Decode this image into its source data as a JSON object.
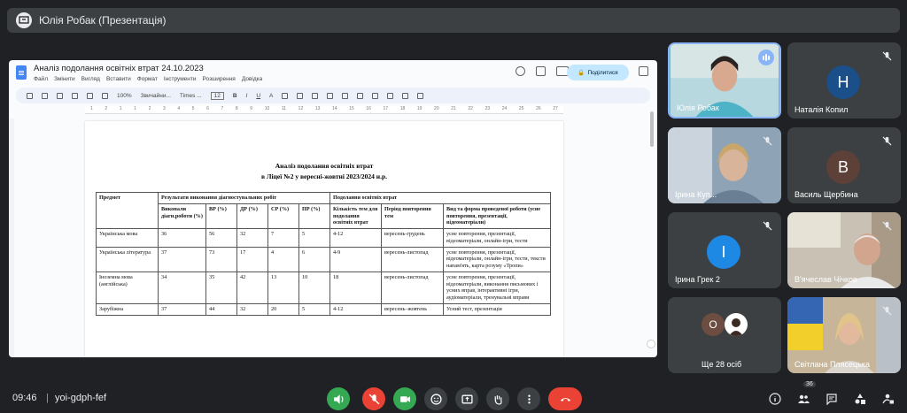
{
  "topbar": {
    "title": "Юлія Робак (Презентація)"
  },
  "doc": {
    "title": "Аналіз подолання освітніх втрат 24.10.2023",
    "menu": [
      "Файл",
      "Змінити",
      "Вигляд",
      "Вставити",
      "Формат",
      "Інструменти",
      "Розширення",
      "Довідка"
    ],
    "share_label": "Поділитися",
    "toolbar": {
      "zoom": "100%",
      "style": "Звичайни...",
      "font": "Times ...",
      "size": "12"
    },
    "ruler": [
      "1",
      "2",
      "1",
      "1",
      "2",
      "3",
      "4",
      "5",
      "6",
      "7",
      "8",
      "9",
      "10",
      "11",
      "12",
      "13",
      "14",
      "15",
      "16",
      "17",
      "18",
      "19",
      "20",
      "21",
      "22",
      "23",
      "24",
      "25",
      "26",
      "27"
    ],
    "heading1": "Аналіз подолання освітніх втрат",
    "heading2": "в Ліцеї №2 у вересні-жовтні 2023/2024 н.р.",
    "table": {
      "h_subject": "Предмет",
      "h_results": "Результати виконання діагностувальних робіт",
      "h_overcome": "Подолання освітніх втрат",
      "sub": [
        "Виконали діагн.роботи (%)",
        "ВР (%)",
        "ДР (%)",
        "СР (%)",
        "ПР (%)",
        "Кількість тем для подолання освітніх втрат",
        "Період повторення тем",
        "Вид та форма проведеної роботи (усне повторення, презентації, відеоматеріали)"
      ],
      "rows": [
        [
          "Українська мова",
          "36",
          "56",
          "32",
          "7",
          "5",
          "4-12",
          "вересень-грудень",
          "усне повторення, презентації, відеоматеріали, онлайн-ігри, тести"
        ],
        [
          "Українська література",
          "37",
          "73",
          "17",
          "4",
          "6",
          "4-9",
          "вересень-листопад",
          "усне повторення, презентації, відеоматеріали, онлайн-ігри, тести, тексти напам'ять, карта розуму «Тропи»"
        ],
        [
          "Іноземна мова (англійська)",
          "34",
          "35",
          "42",
          "13",
          "10",
          "18",
          "вересень-листопад",
          "усне повторення, презентації, відеоматеріали, виконання письмових і усних вправ, інтерактивні ігри, аудіоматеріали, тренувальні вправи"
        ],
        [
          "Зарубіжна",
          "37",
          "44",
          "32",
          "20",
          "5",
          "4-12",
          "вересень–жовтень",
          "Усний тест, презентація"
        ]
      ]
    }
  },
  "participants": {
    "yulia": {
      "name": "Юлія Робак"
    },
    "natalia": {
      "name": "Наталія Копил",
      "initial": "Н",
      "color": "#1a4f8a"
    },
    "iryna_k": {
      "name": "Ірина Куп..."
    },
    "vasyl": {
      "name": "Василь Щербина",
      "initial": "В",
      "color": "#5d4037"
    },
    "iryna_g": {
      "name": "Ірина Грек 2",
      "initial": "І",
      "color": "#1e88e5"
    },
    "viacheslav": {
      "name": "В'ячеслав Чічков"
    },
    "others": {
      "name": "Ще 28 осіб",
      "initial": "О",
      "color": "#6d4c41"
    },
    "svitlana": {
      "name": "Світлана Плясецька"
    }
  },
  "bottom": {
    "time": "09:46",
    "code": "yoi-gdph-fef",
    "people_count": "36"
  },
  "colors": {
    "end_call": "#ea4335",
    "mic_off": "#ea4335",
    "green": "#34a853",
    "dark_btn": "#3c4043"
  }
}
